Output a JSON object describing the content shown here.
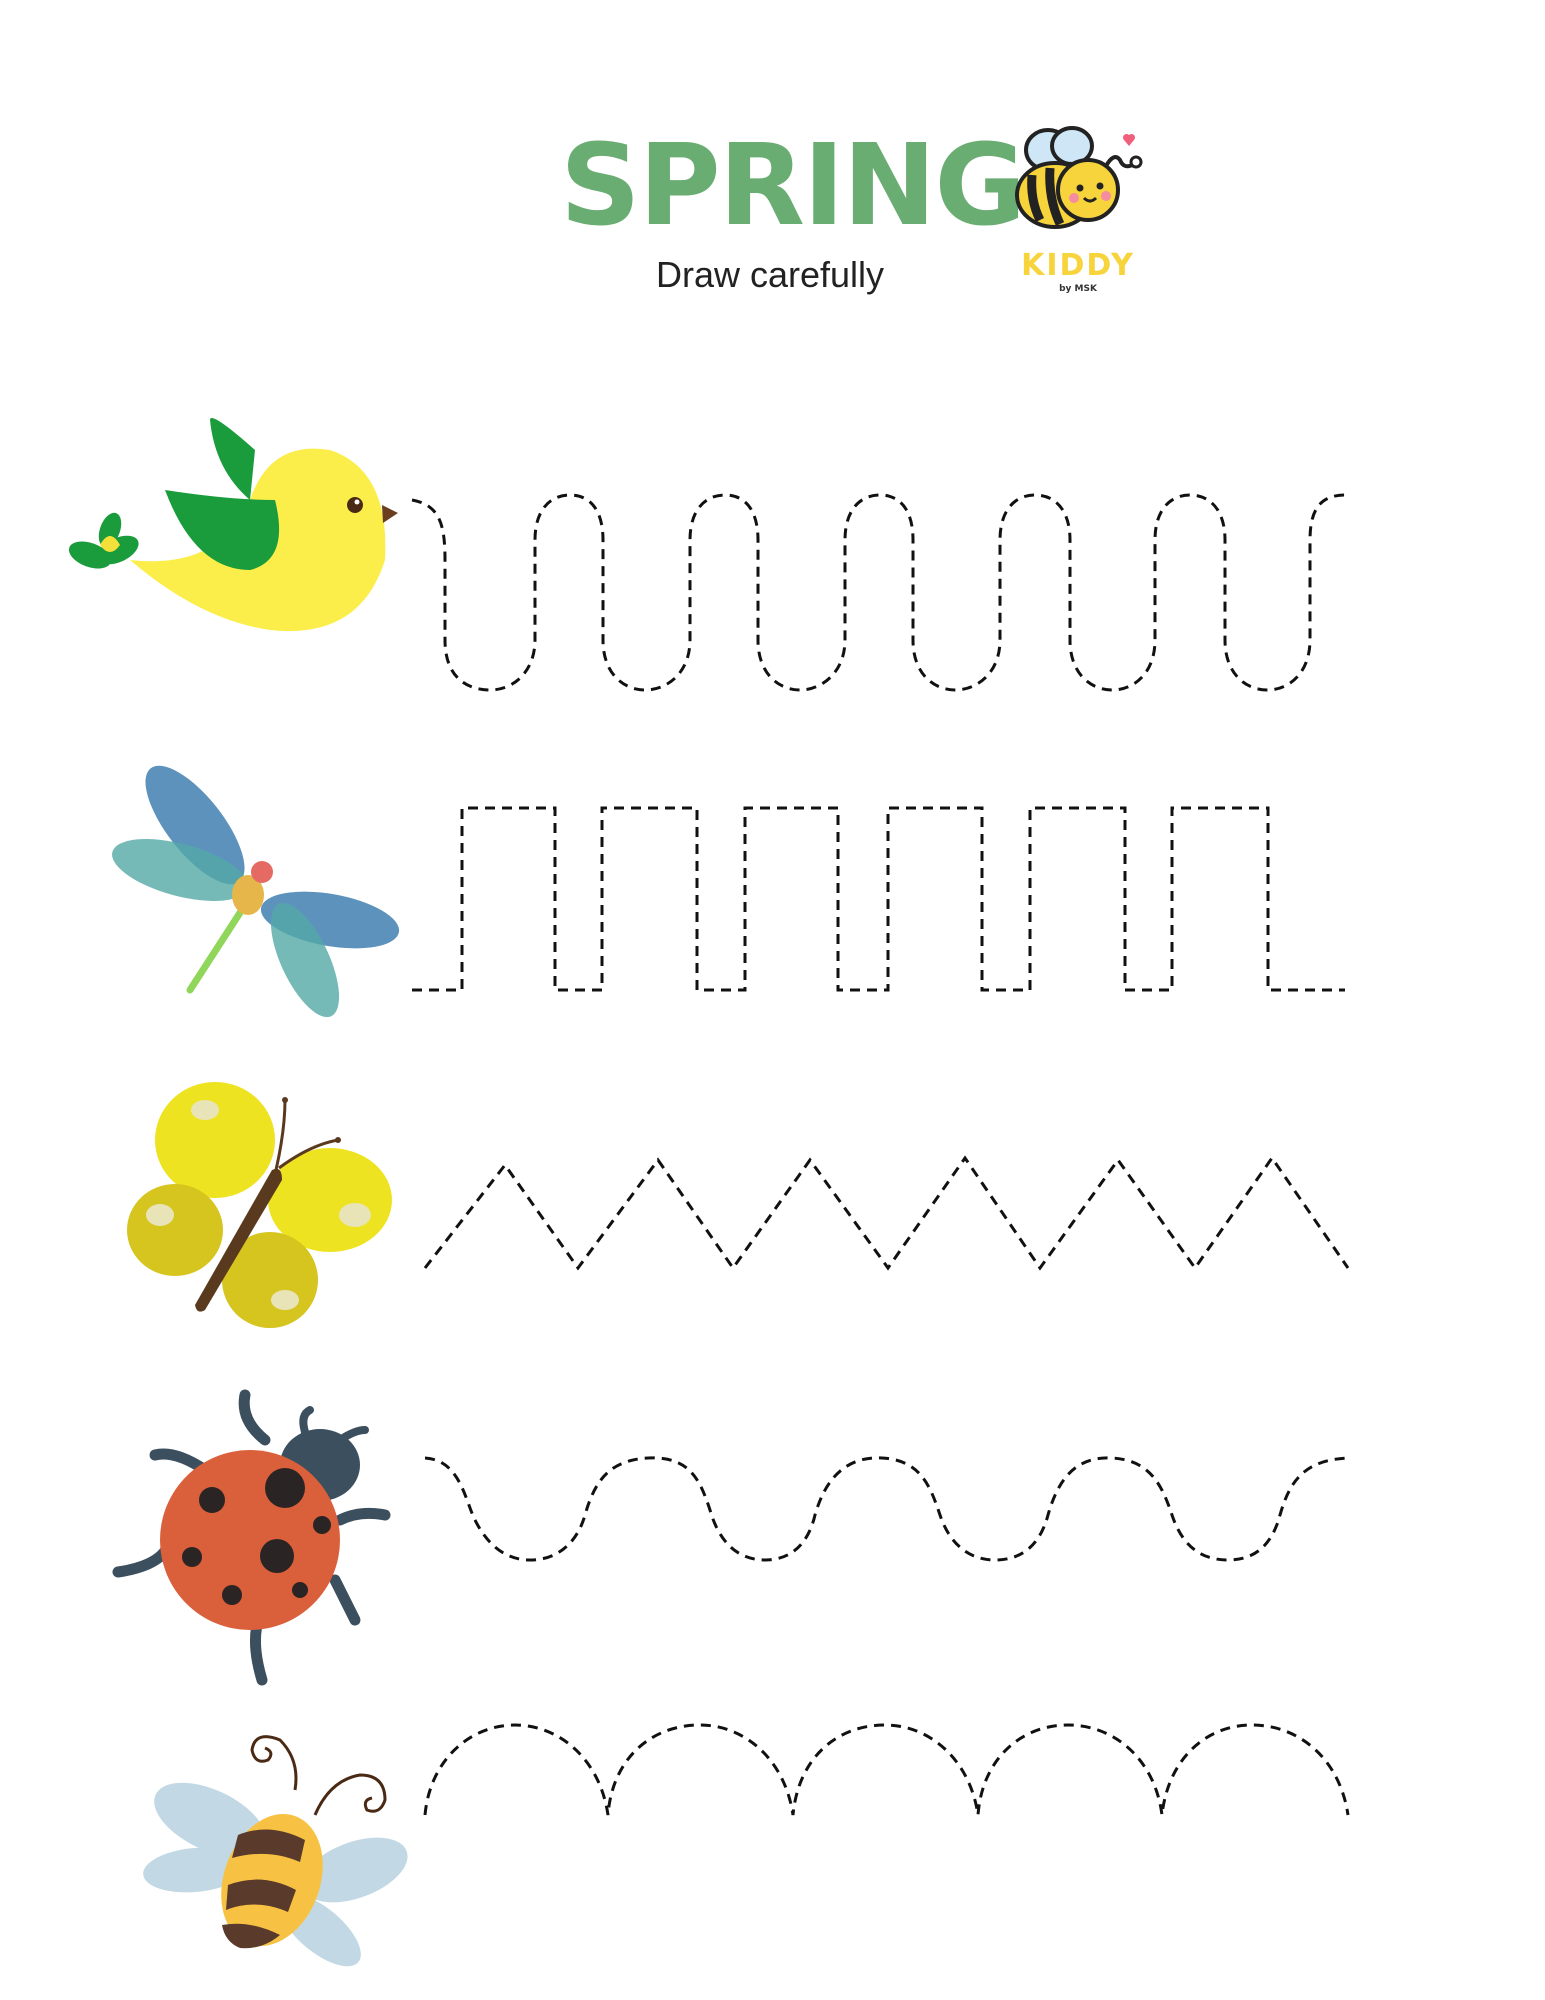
{
  "header": {
    "title": "SPRING",
    "subtitle": "Draw carefully"
  },
  "logo": {
    "name": "KIDDY",
    "byline": "by MSK",
    "icon": "bee-mascot-icon"
  },
  "rows": [
    {
      "icon": "bird-icon",
      "pattern": "loop-wave"
    },
    {
      "icon": "dragonfly-icon",
      "pattern": "square-wave"
    },
    {
      "icon": "butterfly-icon",
      "pattern": "zigzag"
    },
    {
      "icon": "ladybug-icon",
      "pattern": "smooth-wave"
    },
    {
      "icon": "bee-icon",
      "pattern": "arches"
    }
  ],
  "colors": {
    "title": "#6aad73",
    "trace": "#111111"
  }
}
